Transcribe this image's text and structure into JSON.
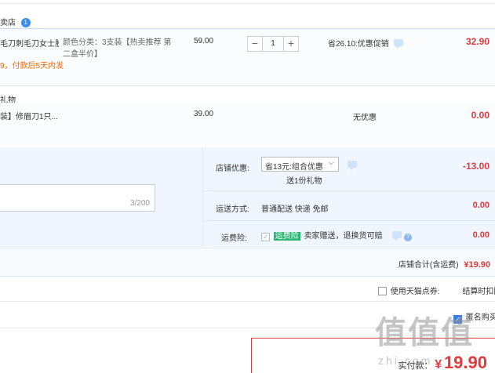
{
  "shop": {
    "name_suffix": "卖店",
    "badge": "1"
  },
  "item1": {
    "title": "毛刀刺毛刀女士脱...",
    "variant": "颜色分类：3支装【热卖推荐 第二盒半价】",
    "shipping_note": "9，付款后5天内发",
    "unit_price": "59.00",
    "quantity": "1",
    "promo": "省26.10:优惠促销",
    "subtotal": "32.90"
  },
  "gift_section_label": "礼物",
  "item2": {
    "title": "装】修眉刀1只...",
    "unit_price": "39.00",
    "promo": "无优惠",
    "subtotal": "0.00"
  },
  "note_counter": "3/200",
  "shop_discount": {
    "label": "店铺优惠:",
    "selected": "省13元:组合优惠",
    "sub": "送1份礼物",
    "amount": "-13.00"
  },
  "delivery": {
    "label": "运送方式:",
    "value": "普通配送 快递 免邮",
    "amount": "0.00"
  },
  "freight_ins": {
    "label": "运费险:",
    "tag": "运费险",
    "value": "卖家赠送，退换货可赔",
    "amount": "0.00"
  },
  "shop_total": {
    "label": "店铺合计(含运费)",
    "amount": "¥19.90"
  },
  "coupon": {
    "label": "使用天猫点券:",
    "right": "结算时扣除"
  },
  "anon": {
    "label": "匿名购买"
  },
  "final": {
    "label": "实付款：",
    "currency": "¥",
    "amount": "19.90"
  },
  "watermark": {
    "main": "值值值",
    "sub": "zhi.com"
  },
  "colors": {
    "price_red": "#e4393c",
    "panel_blue": "#f0f6fe",
    "orange": "#ff6600",
    "checkbox_blue": "#3b7ddd"
  }
}
